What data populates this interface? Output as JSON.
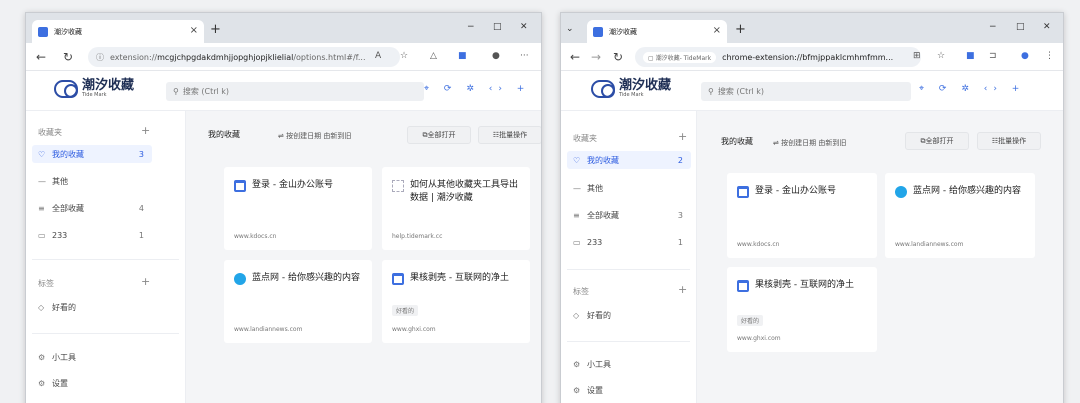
{
  "windows": [
    {
      "tab_title": "潮汐收藏",
      "address_prefix": "extension://",
      "address_main": "mcgjchpgdakdmhjjopghjopjklielial",
      "address_suffix": "/options.html#/f...",
      "window_controls": [
        "−",
        "□",
        "✕"
      ],
      "app": {
        "logo_text": "潮汐收藏",
        "logo_sub": "Tide Mark",
        "search_placeholder": "搜索 (Ctrl k)",
        "header_icons": "⌖ ⟳ ✲ ‹› +"
      },
      "sidebar": {
        "favorites_label": "收藏夹",
        "items": [
          {
            "icon": "♡",
            "label": "我的收藏",
            "count": "3"
          },
          {
            "icon": "—",
            "label": "其他",
            "count": ""
          },
          {
            "icon": "≡",
            "label": "全部收藏",
            "count": "4"
          },
          {
            "icon": "▭",
            "label": "233",
            "count": "1"
          }
        ],
        "tags_label": "标签",
        "tag_items": [
          {
            "icon": "◇",
            "label": "好看的"
          }
        ],
        "tools": [
          {
            "icon": "⚙",
            "label": "小工具"
          },
          {
            "icon": "⚙",
            "label": "设置"
          }
        ]
      },
      "main": {
        "title": "我的收藏",
        "sort": "按创建日期 由新到旧",
        "open_all": "全部打开",
        "batch": "批量操作",
        "cards": [
          {
            "title": "登录 - 金山办公账号",
            "url": "www.kdocs.cn",
            "tag": ""
          },
          {
            "title": "如何从其他收藏夹工具导出数据 | 潮汐收藏",
            "url": "help.tidemark.cc",
            "tag": ""
          },
          {
            "title": "蓝点网 - 给你感兴趣的内容",
            "url": "www.landiannews.com",
            "tag": ""
          },
          {
            "title": "果核剥壳 - 互联网的净土",
            "url": "www.ghxi.com",
            "tag": "好看的"
          }
        ]
      }
    },
    {
      "tab_title": "潮汐收藏",
      "address_chip": "潮汐收藏- TideMark",
      "address_main": "chrome-extension://bfmjppaklcmhmfmm...",
      "window_controls": [
        "−",
        "□",
        "✕"
      ],
      "app": {
        "logo_text": "潮汐收藏",
        "logo_sub": "Tide Mark",
        "search_placeholder": "搜索 (Ctrl k)",
        "header_icons": "⌖ ⟳ ✲ ‹› +"
      },
      "sidebar": {
        "favorites_label": "收藏夹",
        "items": [
          {
            "icon": "♡",
            "label": "我的收藏",
            "count": "2"
          },
          {
            "icon": "—",
            "label": "其他",
            "count": ""
          },
          {
            "icon": "≡",
            "label": "全部收藏",
            "count": "3"
          },
          {
            "icon": "▭",
            "label": "233",
            "count": "1"
          }
        ],
        "tags_label": "标签",
        "tag_items": [
          {
            "icon": "◇",
            "label": "好看的"
          }
        ],
        "tools": [
          {
            "icon": "⚙",
            "label": "小工具"
          },
          {
            "icon": "⚙",
            "label": "设置"
          }
        ]
      },
      "main": {
        "title": "我的收藏",
        "sort": "按创建日期 由新到旧",
        "open_all": "全部打开",
        "batch": "批量操作",
        "cards": [
          {
            "title": "登录 - 金山办公账号",
            "url": "www.kdocs.cn",
            "tag": ""
          },
          {
            "title": "蓝点网 - 给你感兴趣的内容",
            "url": "www.landiannews.com",
            "tag": ""
          },
          {
            "title": "果核剥壳 - 互联网的净土",
            "url": "www.ghxi.com",
            "tag": "好看的"
          }
        ]
      }
    }
  ]
}
